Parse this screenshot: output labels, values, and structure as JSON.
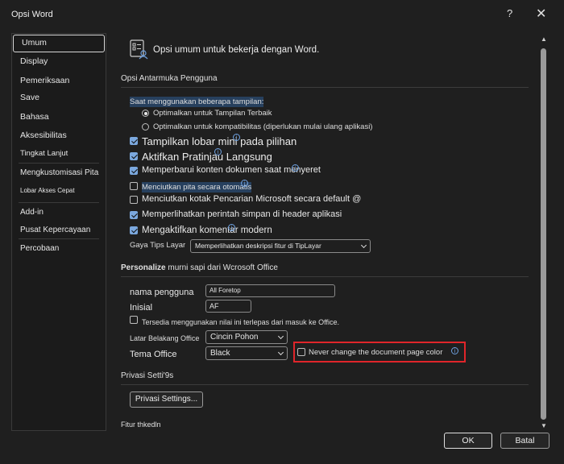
{
  "window": {
    "title": "Opsi Word",
    "help_label": "?",
    "close_label": "✕"
  },
  "sidebar": {
    "items": [
      {
        "label": "Umum"
      },
      {
        "label": "Display"
      },
      {
        "label": "Pemeriksaan"
      },
      {
        "label": "Save"
      },
      {
        "label": "Bahasa"
      },
      {
        "label": "Aksesibilitas"
      },
      {
        "label": "Tingkat Lanjut"
      },
      {
        "label": "Mengkustomisasi Pita"
      },
      {
        "label": "Lobar Akses Cepat"
      },
      {
        "label": "Add-in"
      },
      {
        "label": "Pusat Kepercayaan"
      },
      {
        "label": "Percobaan"
      }
    ]
  },
  "main": {
    "page_heading": "Opsi umum untuk bekerja dengan Word.",
    "ui_section": {
      "header": "Opsi Antarmuka Pengguna",
      "multi_display_label": "Saat menggunakan beberapa tampilan:",
      "radio_best": "Optimalkan untuk Tampilan Terbaik",
      "radio_compat": "Optimalkan untuk kompatibilitas (diperlukan mulai ulang aplikasi)",
      "mini_toolbar": "Tampilkan lobar mini pada pilihan",
      "live_preview": "Aktifkan Pratinjau Langsung",
      "update_content": "Memperbarui konten dokumen saat menyeret",
      "collapse_ribbon": "Menciutkan pita secara otomatis",
      "collapse_search": "Menciutkan kotak Pencarian Microsoft secara default @",
      "show_save": "Memperlihatkan perintah simpan di header aplikasi",
      "modern_comments": "Mengaktifkan komentar modern",
      "tips_style_label": "Gaya Tips Layar",
      "tips_style_value": "Memperlihatkan deskripsi fitur di TipLayar"
    },
    "personalize": {
      "header_bold": "Personalize",
      "header_rest": " murni sapi dari Wcrosoft Office",
      "username_label": "nama pengguna",
      "username_value": "All Foretop",
      "initials_label": "Inisial",
      "initials_value": "AF",
      "always_use": "Tersedia menggunakan nilai ini terlepas dari masuk ke Office.",
      "background_label": "Latar Belakang Office",
      "background_value": "Cincin Pohon",
      "theme_label": "Tema Office",
      "theme_value": "Black",
      "never_change": "Never change the document page color"
    },
    "privacy": {
      "header": "Privasi Setti'9s",
      "button_left": "Privasi",
      "button_right": "Settings..."
    },
    "startup": {
      "header": "Fitur thkedln"
    }
  },
  "footer": {
    "ok_label": "OK",
    "cancel_label": "Batal"
  },
  "colors": {
    "checkbox_on": "#7ba8de",
    "highlight_box": "#e0252a"
  }
}
